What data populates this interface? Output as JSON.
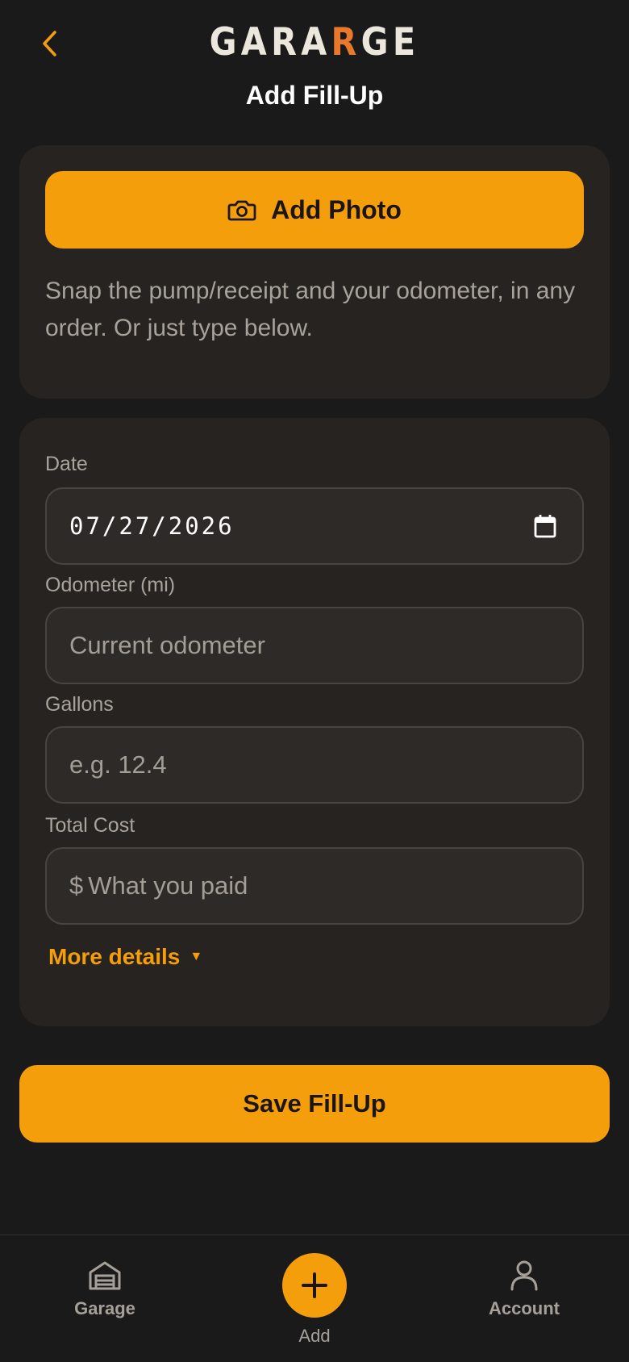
{
  "header": {
    "logo_part1": "GARA",
    "logo_accent": "R",
    "logo_part2": "GE",
    "title": "Add Fill-Up"
  },
  "photo_card": {
    "add_photo_label": "Add Photo",
    "hint": "Snap the pump/receipt and your odometer, in any order. Or just type below."
  },
  "form": {
    "date_label": "Date",
    "date_value": "07/27/2026",
    "odometer_label": "Odometer (mi)",
    "odometer_placeholder": "Current odometer",
    "gallons_label": "Gallons",
    "gallons_placeholder": "e.g. 12.4",
    "cost_label": "Total Cost",
    "cost_prefix": "$",
    "cost_placeholder": "What you paid",
    "more_details_label": "More details",
    "more_details_caret": "▼"
  },
  "save_label": "Save Fill-Up",
  "nav": {
    "items": [
      {
        "label": "Garage",
        "icon": "garage-icon"
      },
      {
        "label": "Add",
        "icon": "plus-icon"
      },
      {
        "label": "Account",
        "icon": "user-icon"
      }
    ]
  },
  "colors": {
    "background": "#1b1a1a",
    "card": "#272321",
    "accent": "#f59e0b",
    "logo_accent": "#e8792c"
  }
}
